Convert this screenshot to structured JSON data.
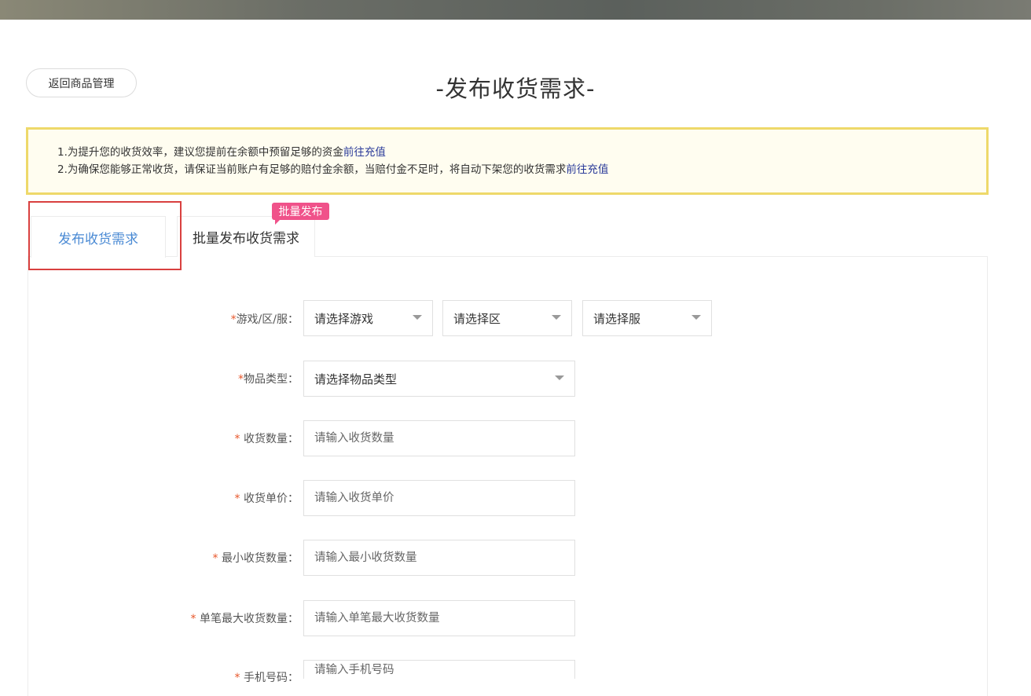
{
  "header": {
    "back_label": "返回商品管理",
    "title": "-发布收货需求-"
  },
  "notice": {
    "line1_text": "1.为提升您的收货效率，建议您提前在余额中预留足够的资金",
    "line1_link": "前往充值",
    "line2_text": "2.为确保您能够正常收货，请保证当前账户有足够的赔付金余额，当赔付金不足时，将自动下架您的收货需求",
    "line2_link": "前往充值"
  },
  "tabs": {
    "single_label": "发布收货需求",
    "batch_label": "批量发布收货需求",
    "batch_badge": "批量发布"
  },
  "form": {
    "required_mark": "*",
    "game_label": "游戏/区/服：",
    "game_select": "请选择游戏",
    "zone_select": "请选择区",
    "server_select": "请选择服",
    "item_type_label": "物品类型：",
    "item_type_select": "请选择物品类型",
    "quantity_label": "收货数量：",
    "quantity_placeholder": "请输入收货数量",
    "unit_price_label": "收货单价：",
    "unit_price_placeholder": "请输入收货单价",
    "min_quantity_label": "最小收货数量：",
    "min_quantity_placeholder": "请输入最小收货数量",
    "max_single_label": "单笔最大收货数量：",
    "max_single_placeholder": "请输入单笔最大收货数量",
    "phone_label": "手机号码：",
    "phone_placeholder": "请输入手机号码"
  },
  "colors": {
    "accent_tab": "#4a8ad4",
    "required": "#e8572b",
    "notice_border": "#eed96a",
    "badge": "#f0528a",
    "highlight_box": "#d9403f",
    "link": "#2a3a99"
  }
}
